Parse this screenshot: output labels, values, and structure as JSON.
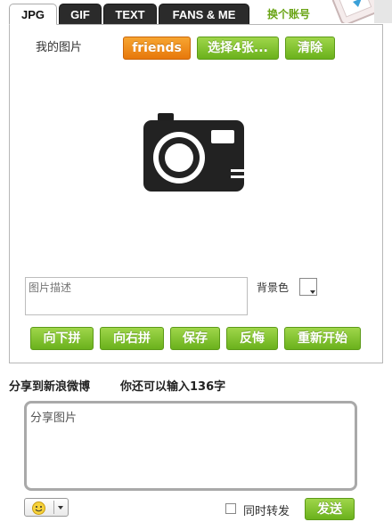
{
  "tabs": [
    {
      "label": "JPG",
      "active": true
    },
    {
      "label": "GIF",
      "active": false
    },
    {
      "label": "TEXT",
      "active": false
    },
    {
      "label": "FANS & ME",
      "active": false
    }
  ],
  "switch_account": "换个账号",
  "panel": {
    "my_pics": "我的图片",
    "friends_button": "friends",
    "select_button": "选择4张...",
    "clear_button": "清除",
    "camera_icon": "camera-icon",
    "description_placeholder": "图片描述",
    "background_label": "背景色",
    "actions": [
      "向下拼",
      "向右拼",
      "保存",
      "反悔",
      "重新开始"
    ]
  },
  "share": {
    "title": "分享到新浪微博",
    "remaining": "你还可以输入136字",
    "text": "分享图片",
    "emoji_icon": "smiley-icon",
    "repost_label": "同时转发",
    "send_button": "发送"
  },
  "colors": {
    "green": "#7cbd2a",
    "orange": "#f08c1a",
    "tab_dark": "#2b2b2b",
    "link_green": "#6aa415"
  }
}
